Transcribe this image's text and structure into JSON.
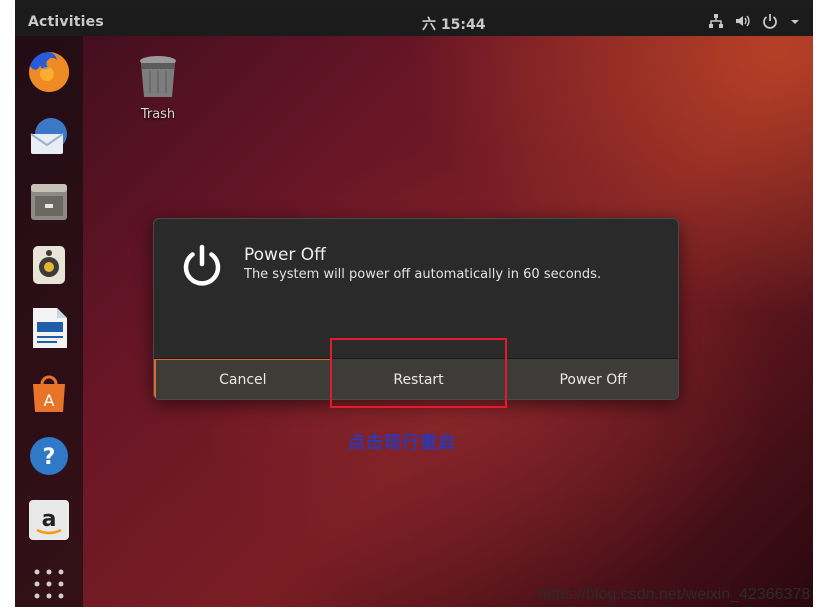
{
  "topbar": {
    "activities": "Activities",
    "clock": "六 15:44"
  },
  "dock": {
    "items": [
      {
        "name": "firefox",
        "icon": "firefox-icon"
      },
      {
        "name": "thunderbird",
        "icon": "thunderbird-icon"
      },
      {
        "name": "files",
        "icon": "files-icon"
      },
      {
        "name": "rhythmbox",
        "icon": "speaker-icon"
      },
      {
        "name": "writer",
        "icon": "writer-icon"
      },
      {
        "name": "software",
        "icon": "software-center-icon"
      },
      {
        "name": "help",
        "icon": "help-icon"
      },
      {
        "name": "amazon",
        "icon": "amazon-icon"
      },
      {
        "name": "show-apps",
        "icon": "apps-grid-icon"
      }
    ]
  },
  "desktop": {
    "trash_label": "Trash"
  },
  "dialog": {
    "title": "Power Off",
    "message": "The system will power off automatically in 60 seconds.",
    "buttons": {
      "cancel": "Cancel",
      "restart": "Restart",
      "power_off": "Power Off"
    }
  },
  "annotation": "点击现行重启",
  "watermark": "https://blog.csdn.net/weixin_42366378",
  "colors": {
    "accent": "#e06a2c",
    "highlight_box": "#e21b2b",
    "annotation_text": "#2c38b4"
  }
}
